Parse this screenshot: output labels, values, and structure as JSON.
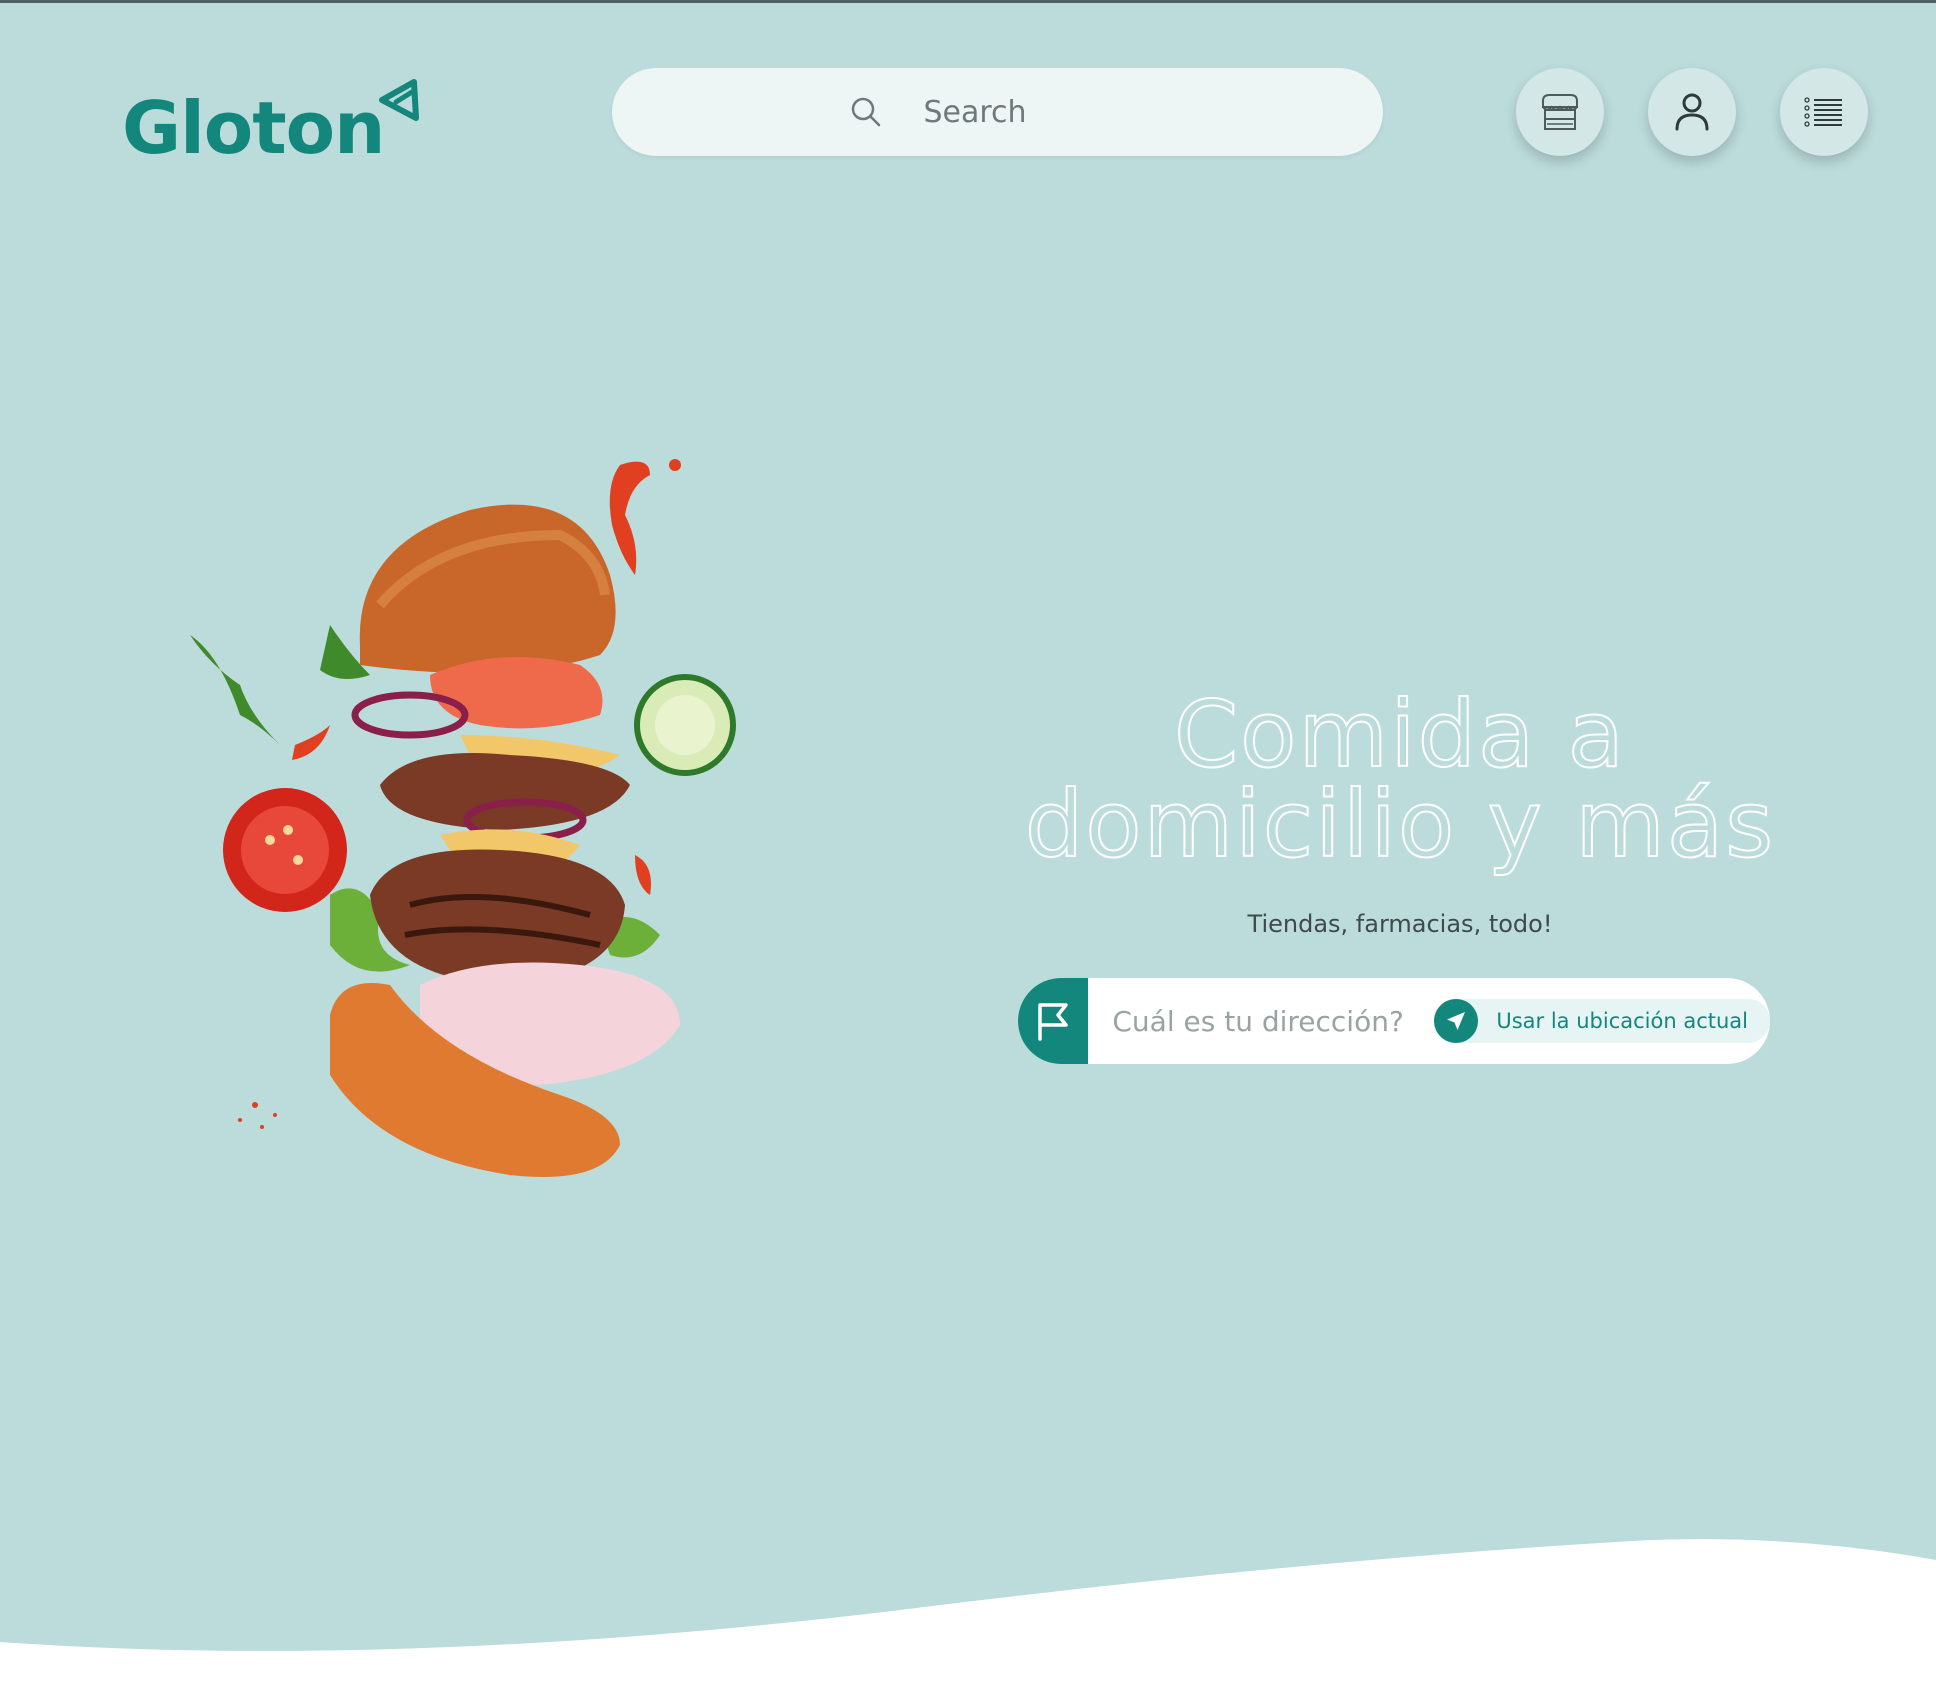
{
  "header": {
    "logo_text": "Gloton",
    "search_placeholder": "Search"
  },
  "icons": {
    "logo_mark": "pizza-slice-icon",
    "search": "search-icon",
    "store": "store-icon",
    "user": "user-icon",
    "menu": "list-menu-icon",
    "flag": "flag-icon",
    "location": "navigation-arrow-icon"
  },
  "hero": {
    "title_line1": "Comida a",
    "title_line2": "domicilio y más",
    "subtitle": "Tiendas, farmacias, todo!"
  },
  "address": {
    "placeholder": "Cuál es tu dirección?",
    "use_location_label": "Usar la ubicación actual"
  },
  "colors": {
    "background": "#bcdbdb",
    "brand": "#13877c",
    "button_bg": "#d4e7e7",
    "white": "#ffffff"
  }
}
